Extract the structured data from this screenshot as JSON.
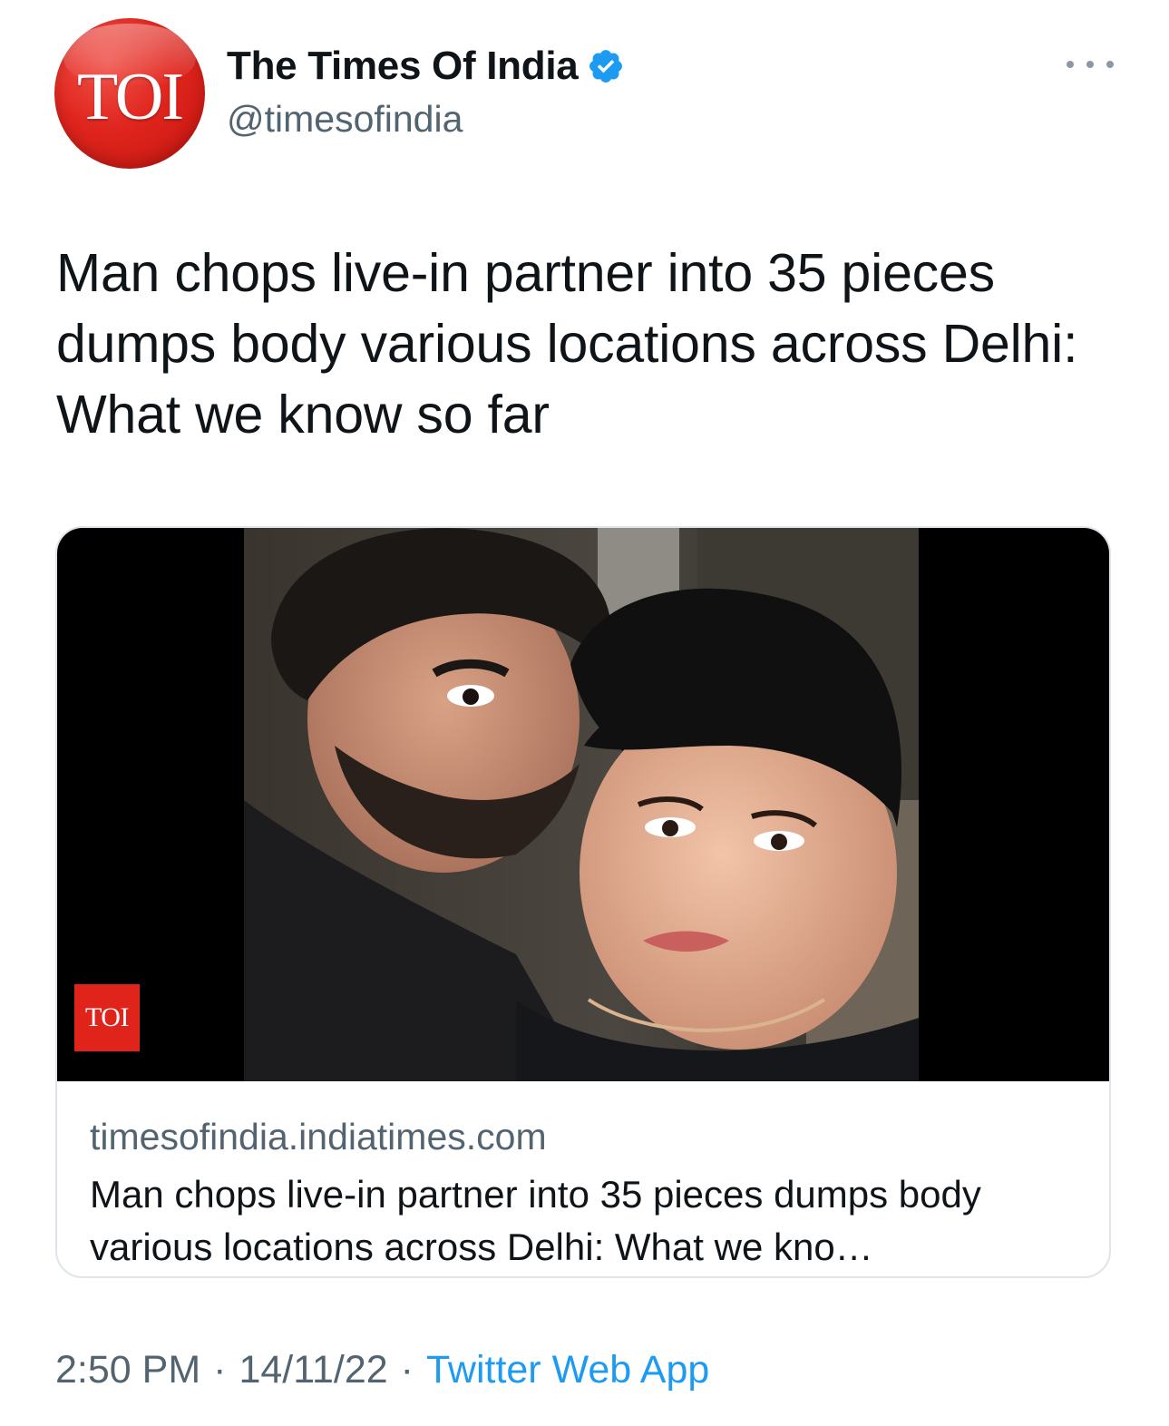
{
  "author": {
    "avatar_text": "TOI",
    "display_name": "The Times Of India",
    "handle": "@timesofindia",
    "verified": true,
    "verified_icon": "verified-badge-icon",
    "avatar_color": "#e0261e"
  },
  "menu": {
    "icon": "more-options-icon"
  },
  "tweet": {
    "text": "Man chops live-in partner into 35 pieces dumps body various locations across Delhi: What we know so far"
  },
  "card": {
    "image_watermark": "TOI",
    "domain": "timesofindia.indiatimes.com",
    "title": "Man chops live-in partner into 35 pieces dumps body various locations across Delhi: What we kno…"
  },
  "meta": {
    "time": "2:50 PM",
    "separator": "·",
    "date": "14/11/22",
    "source": "Twitter Web App"
  },
  "colors": {
    "link": "#1d9bf0",
    "secondary_text": "#536471",
    "primary_text": "#0f1419",
    "card_border": "#dfe5ea"
  }
}
